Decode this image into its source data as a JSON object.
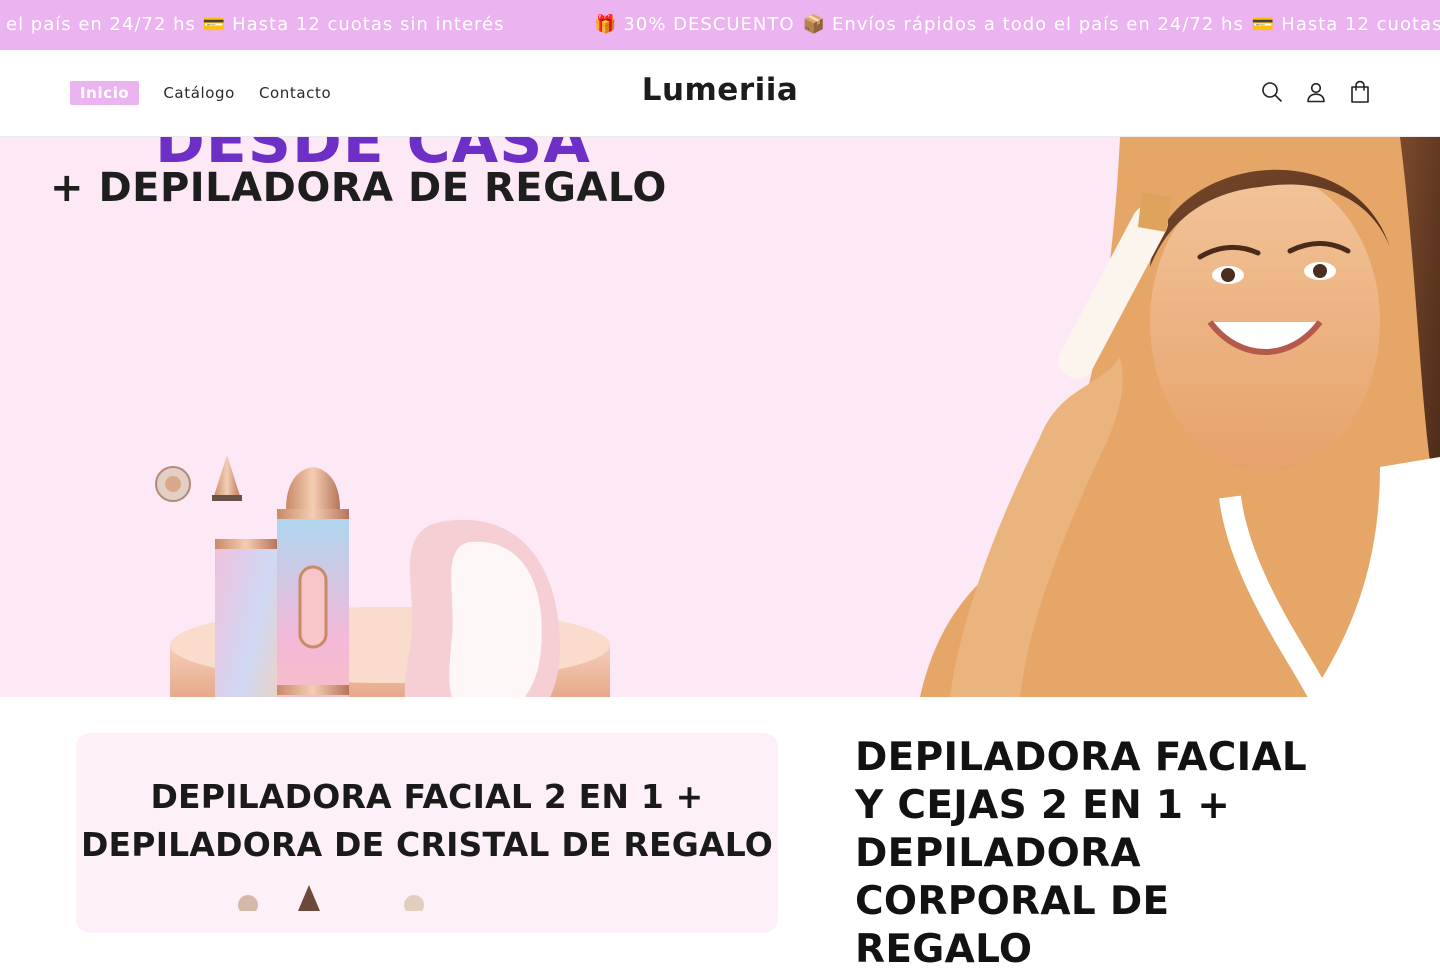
{
  "announcement": {
    "segments": [
      {
        "icon": "gift-icon",
        "text": "30% DESCUENTO"
      },
      {
        "icon": "package-icon",
        "text": "Envíos rápidos a todo el país en 24/72 hs"
      },
      {
        "icon": "credit-card-icon",
        "text": "Hasta 12 cuotas sin interés"
      }
    ],
    "prefix_text": "el país en 24/72 hs",
    "prefix_suffix": "Hasta 12 cuotas sin interés",
    "colors": {
      "background": "#ebb3ef",
      "text": "#ffffff"
    }
  },
  "header": {
    "nav": [
      {
        "label": "Inicio",
        "active": true
      },
      {
        "label": "Catálogo",
        "active": false
      },
      {
        "label": "Contacto",
        "active": false
      }
    ],
    "logo": "Lumeriia",
    "icons": [
      "search-icon",
      "account-icon",
      "cart-icon"
    ]
  },
  "hero": {
    "line1": "DESDE CASA",
    "line2": "+ DEPILADORA DE REGALO"
  },
  "product": {
    "media_line1": "DEPILADORA FACIAL 2 EN 1 +",
    "media_line2": "DEPILADORA DE CRISTAL DE REGALO",
    "title": "DEPILADORA FACIAL Y CEJAS 2 EN 1 + DEPILADORA CORPORAL DE REGALO"
  },
  "colors": {
    "accent": "#ebb3ef",
    "hero_bg": "#fde9f6",
    "hero_headline": "#6e2fc7"
  }
}
